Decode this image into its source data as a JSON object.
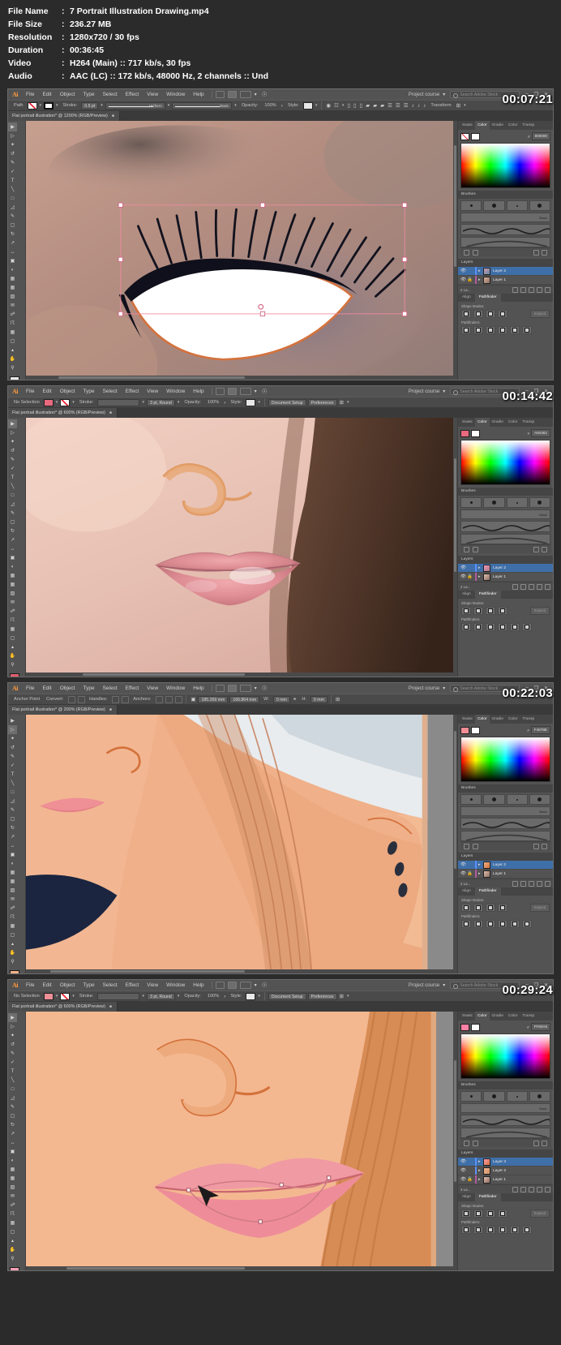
{
  "meta": {
    "rows": [
      {
        "key": "File Name",
        "value": "7 Portrait Illustration Drawing.mp4"
      },
      {
        "key": "File Size",
        "value": "236.27 MB"
      },
      {
        "key": "Resolution",
        "value": "1280x720 / 30 fps"
      },
      {
        "key": "Duration",
        "value": "00:36:45"
      },
      {
        "key": "Video",
        "value": "H264 (Main) :: 717 kb/s, 30 fps"
      },
      {
        "key": "Audio",
        "value": "AAC (LC) :: 172 kb/s, 48000 Hz, 2 channels :: Und"
      }
    ],
    "colon": ":"
  },
  "app": {
    "logo": "Ai",
    "menu": [
      "File",
      "Edit",
      "Object",
      "Type",
      "Select",
      "Effect",
      "View",
      "Window",
      "Help"
    ],
    "workspace": "Project course",
    "search_placeholder": "Search Adobe Stock",
    "window_controls": [
      "–",
      "❐",
      "✕"
    ]
  },
  "panels": [
    {
      "timestamp": "00:07:21",
      "doc_tab": "Flat portrait illustration* @ 1200% (RGB/Preview)",
      "control": {
        "mode_label": "Path",
        "stroke_label": "Stroke:",
        "stroke_weight": "0.5 pt",
        "brush_def": "Uniform",
        "style_def": "Basic",
        "opacity_label": "Opacity:",
        "opacity_value": "100%",
        "style_label": "Style:",
        "transform_label": "Transform"
      },
      "color": {
        "tabs": [
          "Swatc",
          "Color",
          "Gradie",
          "Color",
          "Transp"
        ],
        "active_tab": "Color",
        "hex": "800000"
      },
      "layers": {
        "title": "Layers",
        "items": [
          {
            "name": "Layer 2",
            "selected": true,
            "locked": false
          },
          {
            "name": "Layer 1",
            "selected": false,
            "locked": true
          }
        ],
        "count": "2 La..."
      },
      "pathfinder": {
        "tabs": [
          "Align",
          "Pathfinder"
        ],
        "active": "Pathfinder",
        "shape_modes": "Shape Modes:",
        "pathfinders": "Pathfinders:",
        "expand": "Expand"
      },
      "brushes_title": "Brushes"
    },
    {
      "timestamp": "00:14:42",
      "doc_tab": "Flat portrait illustration* @ 600% (RGB/Preview)",
      "control": {
        "mode_label": "No Selection",
        "stroke_label": "Stroke:",
        "stroke_weight": "3 pt, Round",
        "opacity_label": "Opacity:",
        "opacity_value": "100%",
        "style_label": "Style:",
        "doc_setup": "Document Setup",
        "prefs": "Preferences"
      },
      "color": {
        "tabs": [
          "Swatc",
          "Color",
          "Gradie",
          "Color",
          "Transp"
        ],
        "active_tab": "Color",
        "hex": "A84461"
      },
      "layers": {
        "title": "Layers",
        "items": [
          {
            "name": "Layer 2",
            "selected": true,
            "locked": false
          },
          {
            "name": "Layer 1",
            "selected": false,
            "locked": true
          }
        ],
        "count": "2 La..."
      },
      "pathfinder": {
        "tabs": [
          "Align",
          "Pathfinder"
        ],
        "active": "Pathfinder",
        "shape_modes": "Shape Modes:",
        "pathfinders": "Pathfinders:",
        "expand": "Expand"
      },
      "brushes_title": "Brushes"
    },
    {
      "timestamp": "00:22:03",
      "doc_tab": "Flat portrait illustration* @ 200% (RGB/Preview)",
      "control": {
        "mode_label": "Anchor Point",
        "convert_label": "Convert:",
        "handles_label": "Handles:",
        "anchors_label": "Anchors:",
        "x_value": "185.269 mm",
        "y_value": "166.864 mm",
        "w_label": "W:",
        "w_value": "0 mm",
        "h_label": "H:",
        "h_value": "0 mm"
      },
      "color": {
        "tabs": [
          "Swatc",
          "Color",
          "Gradie",
          "Color",
          "Transp"
        ],
        "active_tab": "Color",
        "hex": "F4878E"
      },
      "layers": {
        "title": "Layers",
        "items": [
          {
            "name": "Layer 2",
            "selected": true,
            "locked": false
          },
          {
            "name": "Layer 1",
            "selected": false,
            "locked": true
          }
        ],
        "count": "2 La..."
      },
      "pathfinder": {
        "tabs": [
          "Align",
          "Pathfinder"
        ],
        "active": "Pathfinder",
        "shape_modes": "Shape Modes:",
        "pathfinders": "Pathfinders:",
        "expand": "Expand"
      },
      "brushes_title": "Brushes"
    },
    {
      "timestamp": "00:29:24",
      "doc_tab": "Flat portrait illustration* @ 600% (RGB/Preview)",
      "control": {
        "mode_label": "No Selection",
        "stroke_label": "Stroke:",
        "stroke_weight": "3 pt, Round",
        "opacity_label": "Opacity:",
        "opacity_value": "100%",
        "style_label": "Style:",
        "doc_setup": "Document Setup",
        "prefs": "Preferences"
      },
      "color": {
        "tabs": [
          "Swatc",
          "Color",
          "Gradie",
          "Color",
          "Transp"
        ],
        "active_tab": "Color",
        "hex": "FF80A5"
      },
      "layers": {
        "title": "Layers",
        "items": [
          {
            "name": "Layer 3",
            "selected": true,
            "locked": false
          },
          {
            "name": "Layer 2",
            "selected": false,
            "locked": false
          },
          {
            "name": "Layer 1",
            "selected": false,
            "locked": true
          }
        ],
        "count": "3 La..."
      },
      "pathfinder": {
        "tabs": [
          "Align",
          "Pathfinder"
        ],
        "active": "Pathfinder",
        "shape_modes": "Shape Modes:",
        "pathfinders": "Pathfinders:",
        "expand": "Expand"
      },
      "brushes_title": "Brushes"
    }
  ],
  "colors": {
    "app_chrome": "#535353",
    "panel_dark": "#454545",
    "layer_selected": "#3f6fa8",
    "ai_orange": "#ff9a3c",
    "skin": "#f0b089",
    "skin_light": "#f6c6a4",
    "lips": "#ef8f96",
    "hair_dark": "#1b2540",
    "outline": "#d4723c"
  }
}
